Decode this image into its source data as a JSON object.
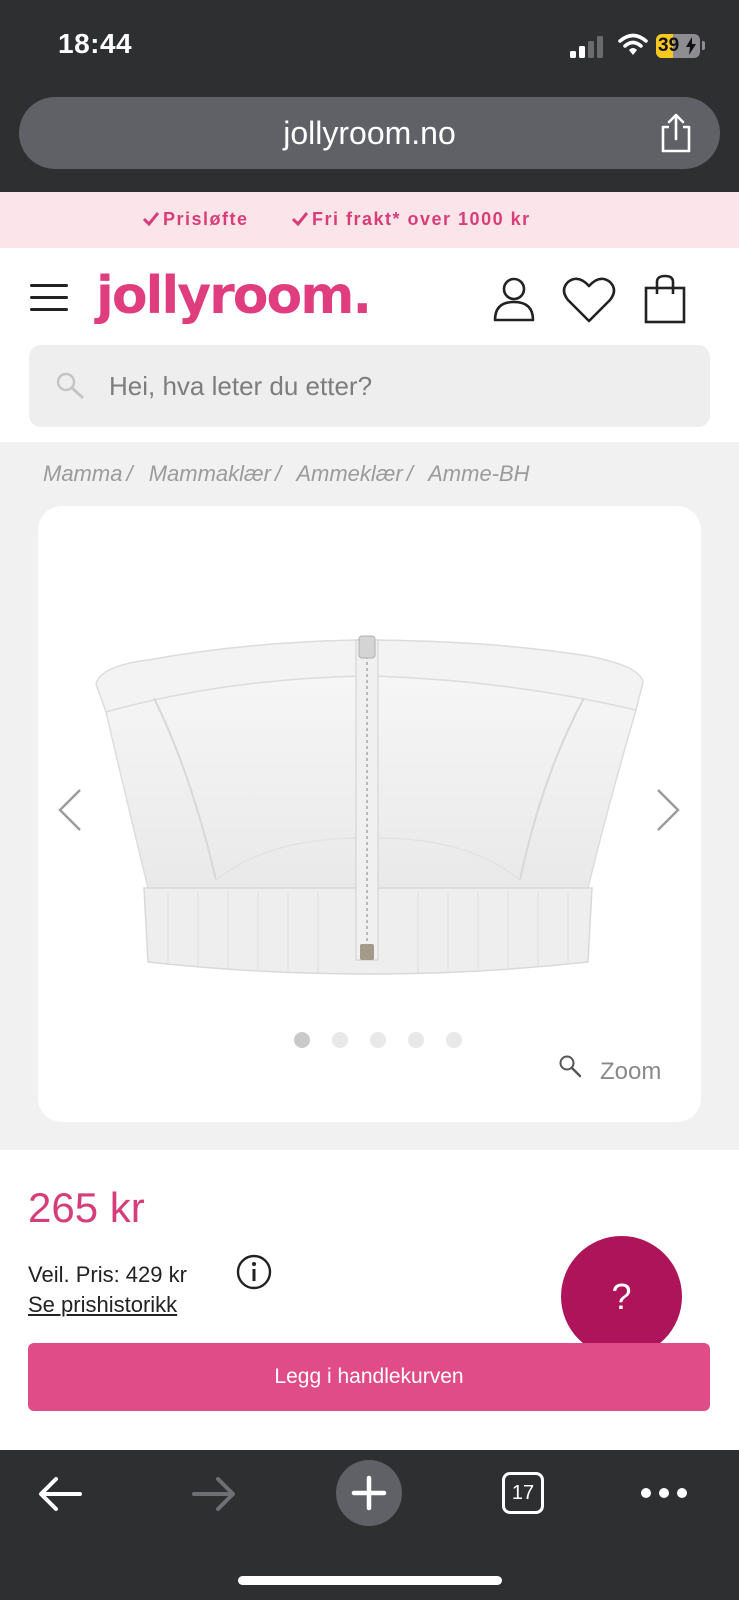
{
  "status_bar": {
    "time": "18:44",
    "battery_level": "39",
    "battery_percent": 39
  },
  "browser": {
    "url": "jollyroom.no",
    "tab_count": "17"
  },
  "promo": {
    "items": [
      "Prisløfte",
      "Fri frakt* over 1000 kr"
    ]
  },
  "header": {
    "logo": "jollyroom.",
    "search_placeholder": "Hei, hva leter du etter?"
  },
  "breadcrumb": [
    "Mamma",
    "Mammaklær",
    "Ammeklær",
    "Amme-BH"
  ],
  "gallery": {
    "slide_count": 5,
    "active_slide": 1,
    "zoom_label": "Zoom"
  },
  "product": {
    "price": "265 kr",
    "rrp": "Veil. Pris: 429 kr",
    "price_history_link": "Se prishistorikk",
    "add_to_cart_label": "Legg i handlekurven",
    "help_label": "?"
  },
  "colors": {
    "brand_pink": "#df3d7e",
    "help_button": "#ad1459",
    "browser_chrome": "#2e2f31"
  }
}
